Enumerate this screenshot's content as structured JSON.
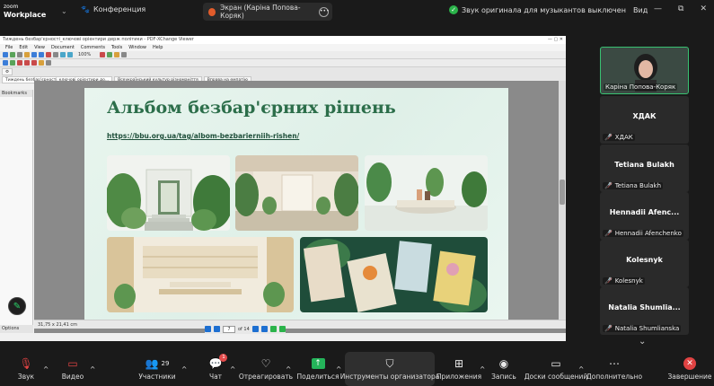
{
  "app": {
    "logo_line1": "zoom",
    "logo_line2": "Workplace"
  },
  "topbar": {
    "conference_label": "Конференция",
    "screen_label": "Экран (Каріна Попова-Коряк)",
    "sound_original": "Звук оригинала для музыкантов выключен",
    "view_label": "Вид"
  },
  "pdf_viewer": {
    "title": "Тиждень безбар'єрності_ключові орієнтири держ політики - PDF-XChange Viewer",
    "menu": [
      "File",
      "Edit",
      "View",
      "Document",
      "Comments",
      "Tools",
      "Window",
      "Help"
    ],
    "tabs": [
      "Тиждень безбар'єрності_ключові орієнтири до...",
      "Всеукраїнський культур різноманіття",
      "Вправа на емпатію"
    ],
    "bookmarks_label": "Bookmarks",
    "options_label": "Options",
    "page_size": "31,75 x 21,41 cm",
    "page_current": "7",
    "page_total": "of 14",
    "zoom": "100%"
  },
  "slide": {
    "title": "Альбом безбар'єрних рішень",
    "link": "https://bbu.org.ua/tag/albom-bezbarierniih-rishen/"
  },
  "participants": [
    {
      "tile_name": "",
      "label": "Каріна Попова-Коряк",
      "video": true
    },
    {
      "tile_name": "ХДАК",
      "label": "ХДАК",
      "video": false
    },
    {
      "tile_name": "Tetiana Bulakh",
      "label": "Tetiana Bulakh",
      "video": false
    },
    {
      "tile_name": "Hennadii Afenc...",
      "label": "Hennadii Afenchenko",
      "video": false
    },
    {
      "tile_name": "Kolesnyk",
      "label": "Kolesnyk",
      "video": false
    },
    {
      "tile_name": "Natalia Shumlia...",
      "label": "Natalia Shumlianska",
      "video": false
    }
  ],
  "toolbar": {
    "audio": "Звук",
    "video": "Видео",
    "participants": "Участники",
    "participants_count": "29",
    "chat": "Чат",
    "chat_badge": "1",
    "react": "Отреагировать",
    "share": "Поделиться",
    "host_tools": "Инструменты организатора",
    "apps": "Приложения",
    "record": "Запись",
    "whiteboards": "Доски сообщений",
    "more": "Дополнительно",
    "end": "Завершение"
  },
  "colors": {
    "accent_green": "#2bb34a",
    "end_red": "#e04343",
    "slide_title": "#2c6e4a",
    "active_speaker": "#38c172"
  }
}
